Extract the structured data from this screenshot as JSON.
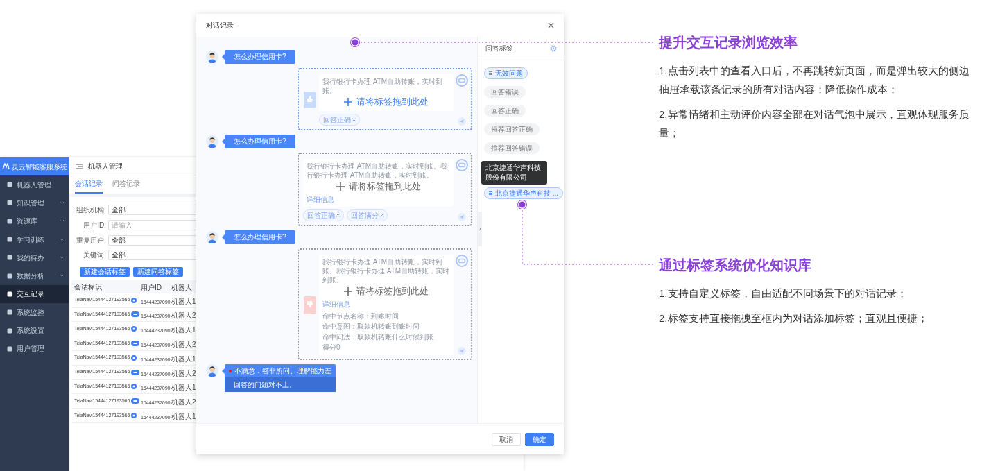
{
  "background_app": {
    "logo": "灵云智能客服系统",
    "menu": [
      {
        "label": "机器人管理",
        "selected": false,
        "expandable": false
      },
      {
        "label": "知识管理",
        "selected": false,
        "expandable": true
      },
      {
        "label": "资源库",
        "selected": false,
        "expandable": true
      },
      {
        "label": "学习训练",
        "selected": false,
        "expandable": true
      },
      {
        "label": "我的待办",
        "selected": false,
        "expandable": true
      },
      {
        "label": "数据分析",
        "selected": false,
        "expandable": true
      },
      {
        "label": "交互记录",
        "selected": true,
        "expandable": false
      },
      {
        "label": "系统监控",
        "selected": false,
        "expandable": false
      },
      {
        "label": "系统设置",
        "selected": false,
        "expandable": false
      },
      {
        "label": "用户管理",
        "selected": false,
        "expandable": false
      }
    ],
    "page_title": "机器人管理",
    "tabs": [
      {
        "label": "会话记录",
        "selected": true
      },
      {
        "label": "问答记录",
        "selected": false
      }
    ],
    "filters": [
      {
        "label": "组织机构:",
        "value": "全部"
      },
      {
        "label": "用户ID:",
        "placeholder": "请输入"
      },
      {
        "label": "重复用户:",
        "value": "全部"
      },
      {
        "label": "关键词:",
        "value": "全部"
      }
    ],
    "buttons": [
      "新建会话标签",
      "新建问答标签"
    ],
    "table": {
      "columns": [
        "会话标识",
        "用户ID",
        "机器人"
      ],
      "rows": [
        {
          "kind": "round",
          "session": "TelaNavi15444127193565",
          "user_id": "15444237090",
          "robot": "机器人1"
        },
        {
          "kind": "wide",
          "session": "TelaNavi15444127193565",
          "user_id": "15444237090",
          "robot": "机器人2"
        },
        {
          "kind": "round",
          "session": "TelaNavi15444127193565",
          "user_id": "15444237090",
          "robot": "机器人1"
        },
        {
          "kind": "wide",
          "session": "TelaNavi15444127193565",
          "user_id": "15444237090",
          "robot": "机器人2"
        },
        {
          "kind": "round",
          "session": "TelaNavi15444127193565",
          "user_id": "15444237090",
          "robot": "机器人1"
        },
        {
          "kind": "wide",
          "session": "TelaNavi15444127193565",
          "user_id": "15444237090",
          "robot": "机器人2"
        },
        {
          "kind": "round",
          "session": "TelaNavi15444127193565",
          "user_id": "15444237090",
          "robot": "机器人1"
        },
        {
          "kind": "wide",
          "session": "TelaNavi15444127193565",
          "user_id": "15444237090",
          "robot": "机器人2"
        },
        {
          "kind": "round",
          "session": "TelaNavi15444127193565",
          "user_id": "15444237090",
          "robot": "机器人1"
        }
      ]
    }
  },
  "dialog": {
    "title": "对话记录",
    "messages": [
      {
        "kind": "question",
        "text": "怎么办理信用卡?"
      },
      {
        "kind": "answer",
        "highlighted": true,
        "liked": true,
        "disliked": false,
        "text": "我行银行卡办理 ATM自助转账，实时到账。",
        "tags": [
          "回答正确"
        ],
        "drop_label": "请将标签拖到此处"
      },
      {
        "kind": "question",
        "text": "怎么办理信用卡?"
      },
      {
        "kind": "answer",
        "highlighted": false,
        "liked": false,
        "disliked": false,
        "text": "我行银行卡办理 ATM自助转账，实时到账。我行银行卡办理 ATM自助转账，实时到账。",
        "detail_label": "详细信息",
        "tags": [
          "回答正确",
          "回答满分"
        ],
        "drop_label": "请将标签拖到此处"
      },
      {
        "kind": "question",
        "text": "怎么办理信用卡?"
      },
      {
        "kind": "answer",
        "highlighted": false,
        "liked": false,
        "disliked": true,
        "text": "我行银行卡办理 ATM自助转账，实时到账。我行银行卡办理 ATM自助转账，实时到账。",
        "detail_label": "详细信息",
        "hits": [
          "命中节点名称：到账时间",
          "命中意图：取款机转账到账时间",
          "命中问法：取款机转账什么时候到账",
          "得分0"
        ],
        "drop_label": "请将标签拖到此处"
      },
      {
        "kind": "feedback",
        "rating": "不满意：答非所问、理解能力差",
        "comment": "回答的问题对不上。"
      }
    ],
    "tag_panel": {
      "title": "问答标签",
      "tooltip": "北京捷通华声科技股份有限公司",
      "tags": [
        {
          "label": "无效问题",
          "selected": true,
          "hovered": false
        },
        {
          "label": "回答错误",
          "selected": false,
          "hovered": false
        },
        {
          "label": "回答正确",
          "selected": false,
          "hovered": false
        },
        {
          "label": "推荐回答正确",
          "selected": false,
          "hovered": false
        },
        {
          "label": "推荐回答错误",
          "selected": false,
          "hovered": false
        },
        {
          "label": "北京捷通华声科技 ...",
          "selected": true,
          "hovered": true
        }
      ]
    },
    "buttons": [
      {
        "label": "取消",
        "kind": "secondary"
      },
      {
        "label": "确定",
        "kind": "primary"
      }
    ]
  },
  "annotations": [
    {
      "title": "提升交互记录浏览效率",
      "points": [
        "1.点击列表中的查看入口后，不再跳转新页面，而是弹出较大的侧边抽屉承载该条记录的所有对话内容；降低操作成本；",
        "2.异常情绪和主动评价内容全部在对话气泡中展示，直观体现服务质量；"
      ]
    },
    {
      "title": "通过标签系统优化知识库",
      "points": [
        "1.支持自定义标签，自由适配不同场景下的对话记录；",
        "2.标签支持直接拖拽至框内为对话添加标签；直观且便捷；"
      ]
    }
  ]
}
